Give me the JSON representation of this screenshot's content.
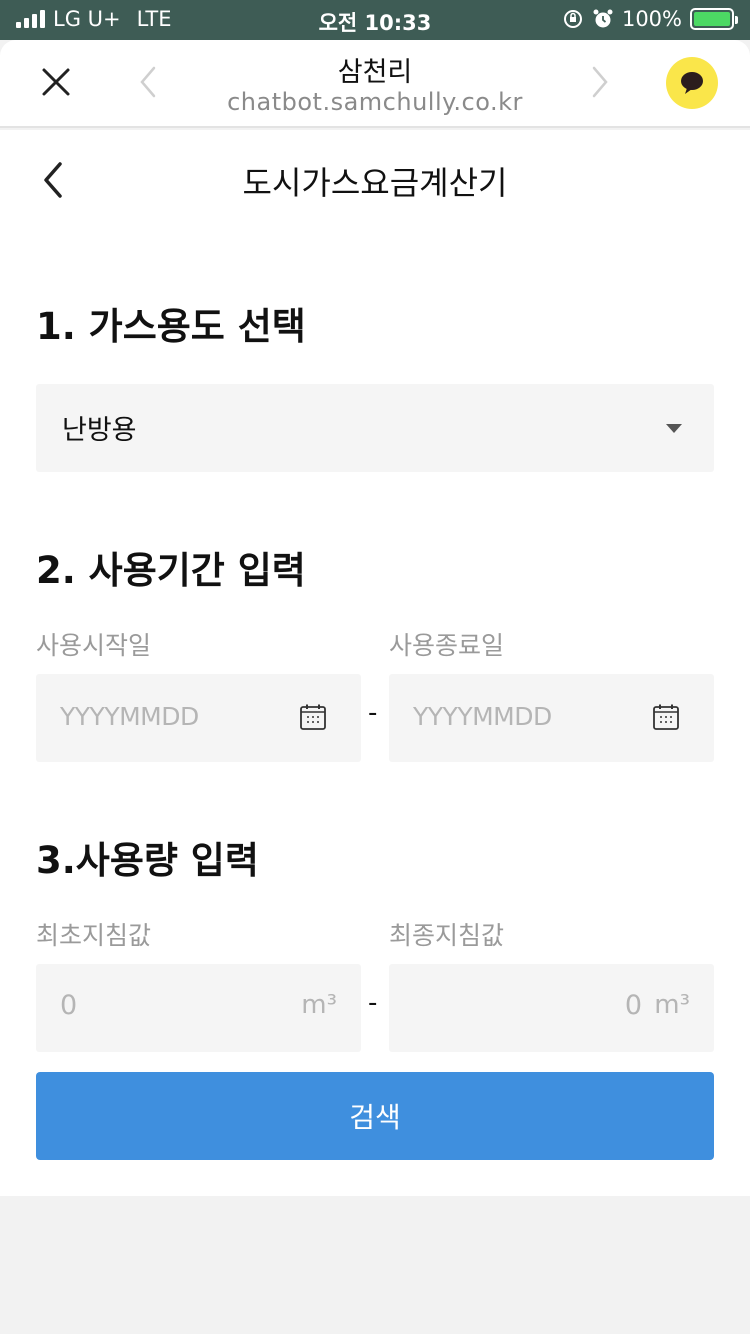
{
  "status_bar": {
    "carrier": "LG U+",
    "network": "LTE",
    "time": "오전 10:33",
    "battery": "100%"
  },
  "browser": {
    "title": "삼천리",
    "url": "chatbot.samchully.co.kr"
  },
  "page": {
    "title": "도시가스요금계산기"
  },
  "section1": {
    "title": "1. 가스용도 선택",
    "selected": "난방용"
  },
  "section2": {
    "title": "2. 사용기간 입력",
    "start_label": "사용시작일",
    "end_label": "사용종료일",
    "start_placeholder": "YYYYMMDD",
    "end_placeholder": "YYYYMMDD",
    "separator": "-"
  },
  "section3": {
    "title": "3.사용량 입력",
    "first_label": "최초지침값",
    "final_label": "최종지침값",
    "first_value": "0",
    "final_value": "0",
    "unit": "m³",
    "separator": "-"
  },
  "search_button": "검색"
}
